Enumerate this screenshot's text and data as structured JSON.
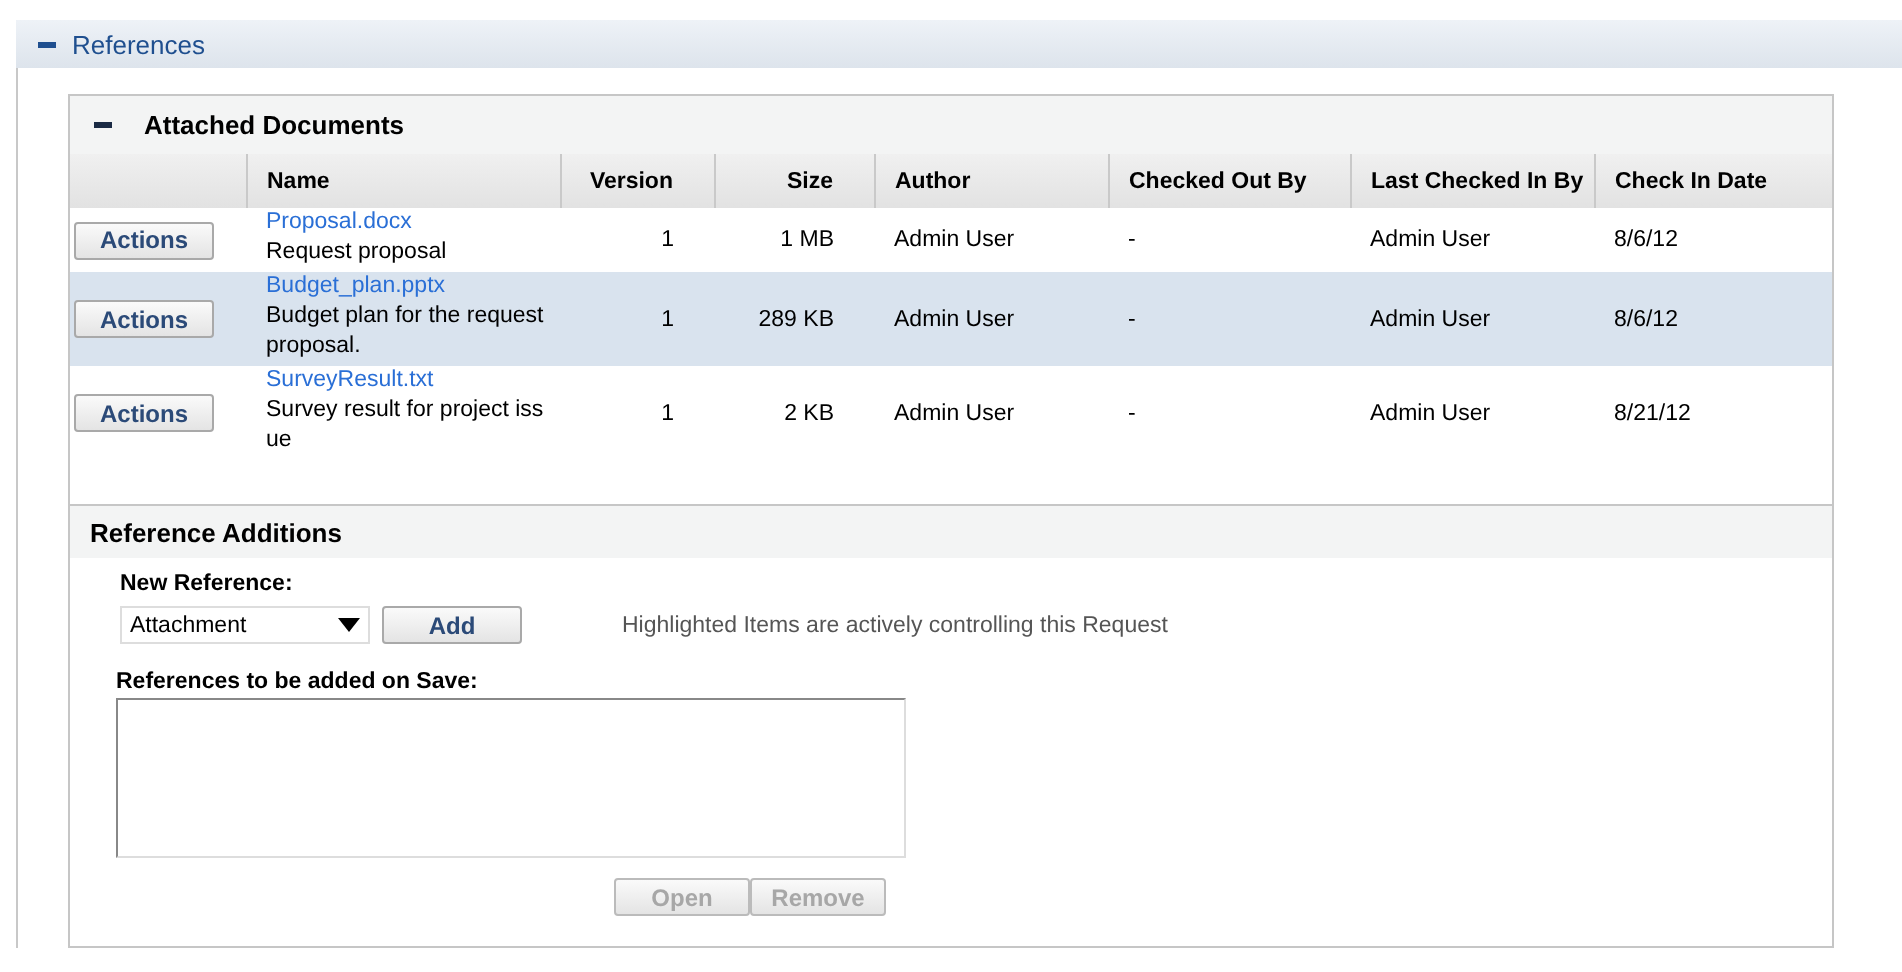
{
  "section": {
    "title": "References",
    "expanded": true
  },
  "attached": {
    "title": "Attached Documents",
    "expanded": true,
    "columns": [
      "Name",
      "Version",
      "Size",
      "Author",
      "Checked Out By",
      "Last Checked In By",
      "Check In Date"
    ],
    "rows": [
      {
        "action": "Actions",
        "name": "Proposal.docx",
        "description": "Request proposal",
        "version": "1",
        "size": "1 MB",
        "author": "Admin User",
        "checked_out_by": "-",
        "last_checked_in_by": "Admin User",
        "check_in_date": "8/6/12",
        "highlighted": false
      },
      {
        "action": "Actions",
        "name": "Budget_plan.pptx",
        "description": "Budget plan for the request proposal.",
        "version": "1",
        "size": "289 KB",
        "author": "Admin User",
        "checked_out_by": "-",
        "last_checked_in_by": "Admin User",
        "check_in_date": "8/6/12",
        "highlighted": true
      },
      {
        "action": "Actions",
        "name": "SurveyResult.txt",
        "description": "Survey result for project issue",
        "version": "1",
        "size": "2 KB",
        "author": "Admin User",
        "checked_out_by": "-",
        "last_checked_in_by": "Admin User",
        "check_in_date": "8/21/12",
        "highlighted": false
      }
    ]
  },
  "additions": {
    "title": "Reference Additions",
    "new_reference_label": "New Reference:",
    "dropdown_value": "Attachment",
    "add_button": {
      "label": "Add",
      "disabled": false
    },
    "hint": "Highlighted Items are actively controlling this Request",
    "list_label": "References to be added on Save:",
    "buttons": [
      {
        "label": "Open",
        "disabled": true
      },
      {
        "label": "Remove",
        "disabled": true
      }
    ]
  }
}
